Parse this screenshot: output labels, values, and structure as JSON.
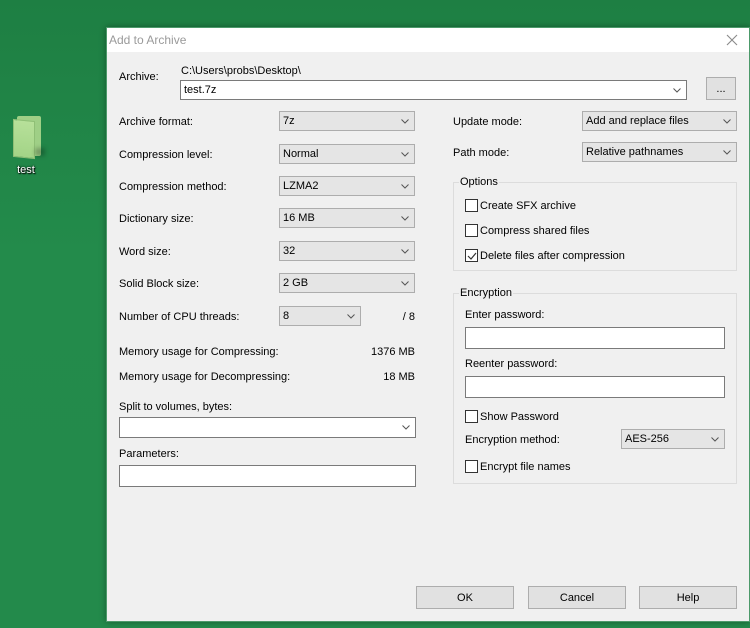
{
  "desktop": {
    "icon_label": "test"
  },
  "dialog": {
    "title": "Add to Archive",
    "archive": {
      "label": "Archive:",
      "path": "C:\\Users\\probs\\Desktop\\",
      "filename": "test.7z",
      "browse_label": "..."
    },
    "left": {
      "archive_format": {
        "label": "Archive format:",
        "value": "7z"
      },
      "compression_level": {
        "label": "Compression level:",
        "value": "Normal"
      },
      "compression_method": {
        "label": "Compression method:",
        "value": "LZMA2"
      },
      "dictionary_size": {
        "label": "Dictionary size:",
        "value": "16 MB"
      },
      "word_size": {
        "label": "Word size:",
        "value": "32"
      },
      "solid_block_size": {
        "label": "Solid Block size:",
        "value": "2 GB"
      },
      "cpu_threads": {
        "label": "Number of CPU threads:",
        "value": "8",
        "max": "/ 8"
      },
      "mem_compress": {
        "label": "Memory usage for Compressing:",
        "value": "1376 MB"
      },
      "mem_decompress": {
        "label": "Memory usage for Decompressing:",
        "value": "18 MB"
      },
      "split_volumes": {
        "label": "Split to volumes, bytes:",
        "value": ""
      },
      "parameters": {
        "label": "Parameters:",
        "value": ""
      }
    },
    "right": {
      "update_mode": {
        "label": "Update mode:",
        "value": "Add and replace files"
      },
      "path_mode": {
        "label": "Path mode:",
        "value": "Relative pathnames"
      },
      "options": {
        "title": "Options",
        "items": [
          {
            "label": "Create SFX archive",
            "checked": false
          },
          {
            "label": "Compress shared files",
            "checked": false
          },
          {
            "label": "Delete files after compression",
            "checked": true
          }
        ]
      },
      "encryption": {
        "title": "Encryption",
        "enter_password_label": "Enter password:",
        "enter_password_value": "",
        "reenter_password_label": "Reenter password:",
        "reenter_password_value": "",
        "show_password": {
          "label": "Show Password",
          "checked": false
        },
        "method_label": "Encryption method:",
        "method_value": "AES-256",
        "encrypt_names": {
          "label": "Encrypt file names",
          "checked": false
        }
      }
    },
    "buttons": {
      "ok": "OK",
      "cancel": "Cancel",
      "help": "Help"
    }
  }
}
